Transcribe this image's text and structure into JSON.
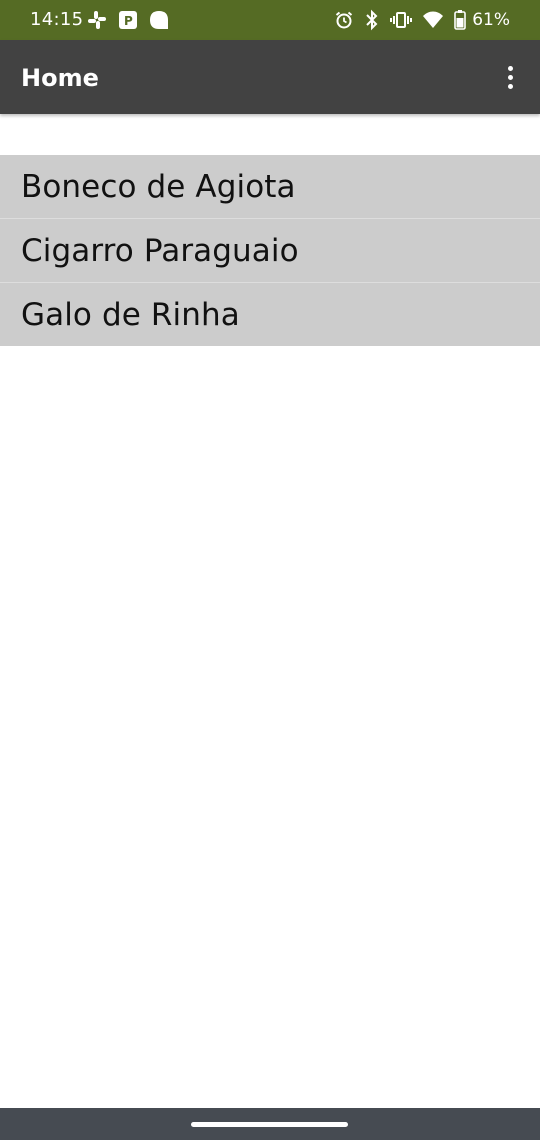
{
  "status_bar": {
    "time": "14:15",
    "battery": "61%",
    "left_icons": [
      "slack-icon",
      "parking-icon",
      "notification-blob-icon"
    ],
    "right_icons": [
      "alarm-icon",
      "bluetooth-icon",
      "vibrate-icon",
      "wifi-icon",
      "battery-icon"
    ]
  },
  "app_bar": {
    "title": "Home",
    "menu_icon": "more-vertical-icon"
  },
  "list": {
    "items": [
      {
        "label": "Boneco de Agiota"
      },
      {
        "label": "Cigarro Paraguaio"
      },
      {
        "label": "Galo de Rinha"
      }
    ]
  },
  "colors": {
    "status_bar": "#556b24",
    "app_bar": "#424242",
    "list_item_bg": "#cccccc",
    "nav_bar": "#464b52"
  }
}
